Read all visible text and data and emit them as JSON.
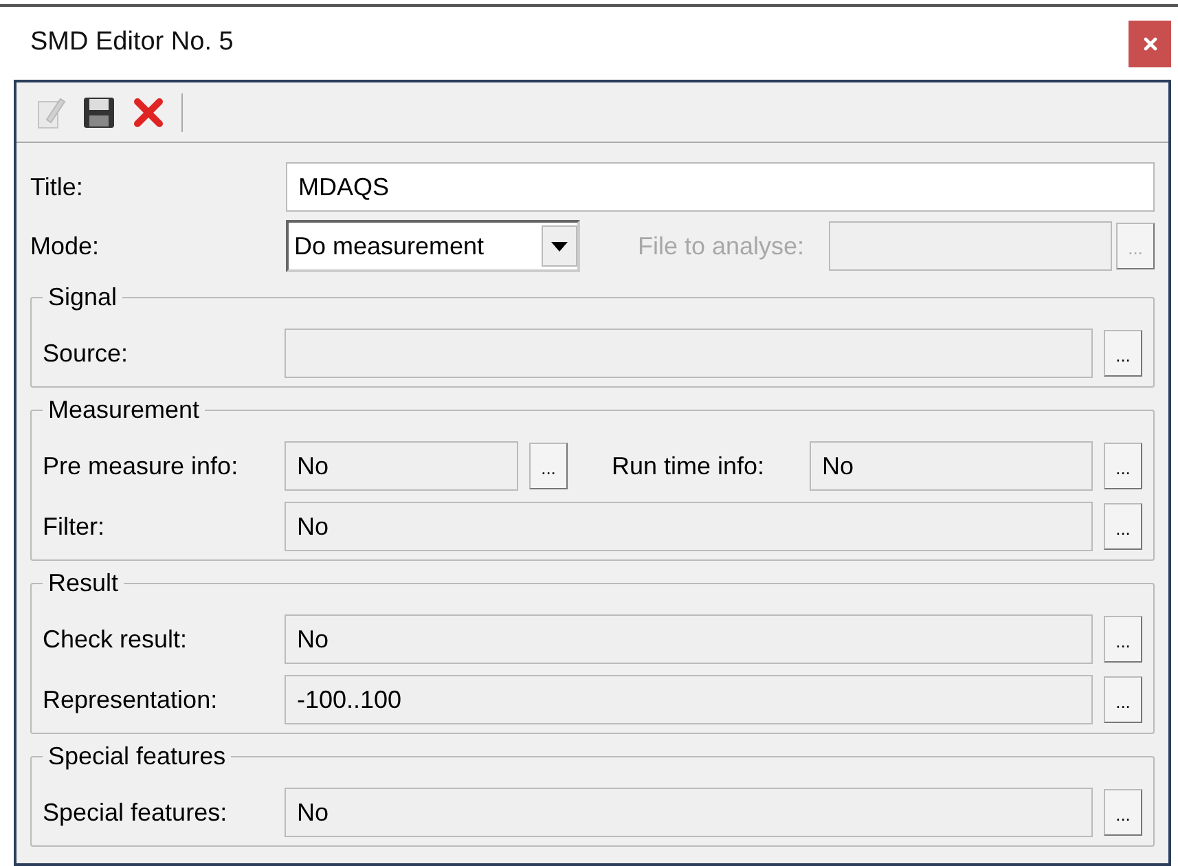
{
  "window": {
    "title": "SMD Editor No. 5"
  },
  "toolbar": [
    {
      "kind": "edit",
      "disabled": true
    },
    {
      "kind": "save",
      "disabled": false
    },
    {
      "kind": "delete",
      "disabled": false
    }
  ],
  "title_field": {
    "label": "Title:",
    "value": "MDAQS"
  },
  "mode": {
    "label": "Mode:",
    "value": "Do measurement",
    "file_label": "File to analyse:",
    "file_disabled": true,
    "file_button": "..."
  },
  "groups": [
    {
      "title": "Signal",
      "rows": [
        [
          {
            "label": "Source:",
            "button": "..."
          }
        ]
      ]
    },
    {
      "title": "Measurement",
      "rows": [
        [
          {
            "label": "Pre measure info:",
            "value": "No",
            "button": "..."
          },
          {
            "label": "Run time info:",
            "value": "No",
            "button": "..."
          }
        ],
        [
          {
            "label": "Filter:",
            "value": "No",
            "button": "..."
          }
        ]
      ]
    },
    {
      "title": "Result",
      "rows": [
        [
          {
            "label": "Check result:",
            "value": "No",
            "button": "..."
          }
        ],
        [
          {
            "label": "Representation:",
            "value": "-100..100",
            "button": "..."
          }
        ]
      ]
    },
    {
      "title": "Special features",
      "rows": [
        [
          {
            "label": "Special features:",
            "value": "No",
            "button": "..."
          }
        ]
      ]
    }
  ]
}
